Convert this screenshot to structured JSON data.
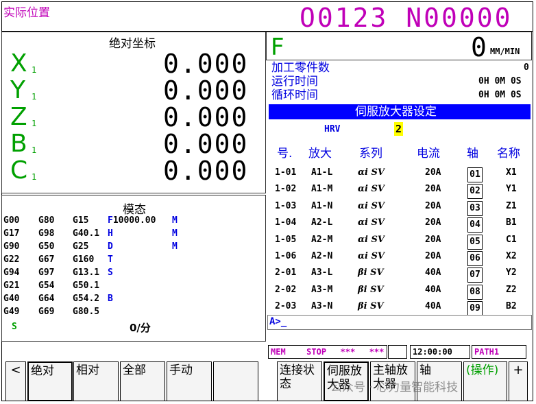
{
  "header": {
    "mode_label": "实际位置",
    "program_number": "O0123 N00000"
  },
  "abs_coords": {
    "title": "绝对坐标",
    "axes": [
      {
        "name": "X",
        "sub": "1",
        "value": "0.000"
      },
      {
        "name": "Y",
        "sub": "1",
        "value": "0.000"
      },
      {
        "name": "Z",
        "sub": "1",
        "value": "0.000"
      },
      {
        "name": "B",
        "sub": "1",
        "value": "0.000"
      },
      {
        "name": "C",
        "sub": "1",
        "value": "0.000"
      }
    ]
  },
  "feed": {
    "label": "F",
    "value": "0",
    "unit": "MM/MIN",
    "parts_label": "加工零件数",
    "parts_value": "0",
    "run_time_label": "运行时间",
    "run_time_value": "0H 0M 0S",
    "cycle_time_label": "循环时间",
    "cycle_time_value": "0H 0M 0S"
  },
  "modal": {
    "title": "模态",
    "rows": [
      [
        "G00",
        "G80",
        "G15",
        "F10000.00",
        "M"
      ],
      [
        "G17",
        "G98",
        "G40.1",
        "H",
        "M"
      ],
      [
        "G90",
        "G50",
        "G25",
        "D",
        "M"
      ],
      [
        "G22",
        "G67",
        "G160",
        "T",
        ""
      ],
      [
        "G94",
        "G97",
        "G13.1",
        "S",
        ""
      ],
      [
        "G21",
        "G54",
        "G50.1",
        "",
        ""
      ],
      [
        "G40",
        "G64",
        "G54.2",
        "B",
        ""
      ],
      [
        "G49",
        "G69",
        "G80.5",
        "",
        ""
      ]
    ],
    "s_label": "S",
    "s_value": "0/分"
  },
  "servo": {
    "title": "伺服放大器设定",
    "hrv_label": "HRV",
    "hrv_value": "2",
    "columns": [
      "号.",
      "放大",
      "系列",
      "电流",
      "轴",
      "名称"
    ],
    "rows": [
      {
        "no": "1-01",
        "amp": "A1-L",
        "series": "αi SV",
        "current": "20A",
        "axis": "01",
        "name": "X1"
      },
      {
        "no": "1-02",
        "amp": "A1-M",
        "series": "αi SV",
        "current": "20A",
        "axis": "02",
        "name": "Y1"
      },
      {
        "no": "1-03",
        "amp": "A1-N",
        "series": "αi SV",
        "current": "20A",
        "axis": "03",
        "name": "Z1"
      },
      {
        "no": "1-04",
        "amp": "A2-L",
        "series": "αi SV",
        "current": "20A",
        "axis": "04",
        "name": "B1"
      },
      {
        "no": "1-05",
        "amp": "A2-M",
        "series": "αi SV",
        "current": "20A",
        "axis": "05",
        "name": "C1"
      },
      {
        "no": "1-06",
        "amp": "A2-N",
        "series": "αi SV",
        "current": "20A",
        "axis": "06",
        "name": "X2"
      },
      {
        "no": "2-01",
        "amp": "A3-L",
        "series": "βi SV",
        "current": "40A",
        "axis": "07",
        "name": "Y2"
      },
      {
        "no": "2-02",
        "amp": "A3-M",
        "series": "βi SV",
        "current": "40A",
        "axis": "08",
        "name": "Z2"
      },
      {
        "no": "2-03",
        "amp": "A3-N",
        "series": "βi SV",
        "current": "40A",
        "axis": "09",
        "name": "B2"
      }
    ]
  },
  "input_line": "A>_",
  "status": {
    "mode": "MEM",
    "state": "STOP",
    "stars1": "***",
    "stars2": "***",
    "time": "12:00:00",
    "path": "PATH1"
  },
  "softkeys_left": {
    "prev": "<",
    "keys": [
      "绝对",
      "相对",
      "全部",
      "手动",
      ""
    ]
  },
  "softkeys_right": {
    "keys": [
      "连接状态",
      "伺服放大器",
      "主轴放大器",
      "轴",
      "(操作)"
    ],
    "next": "+"
  },
  "watermark": "公众号 · 心力量智能科技",
  "colors": {
    "accent_magenta": "#c000b8",
    "axis_green": "#00a000",
    "title_blue": "#0000e0",
    "servo_bar": "#0000ff"
  }
}
